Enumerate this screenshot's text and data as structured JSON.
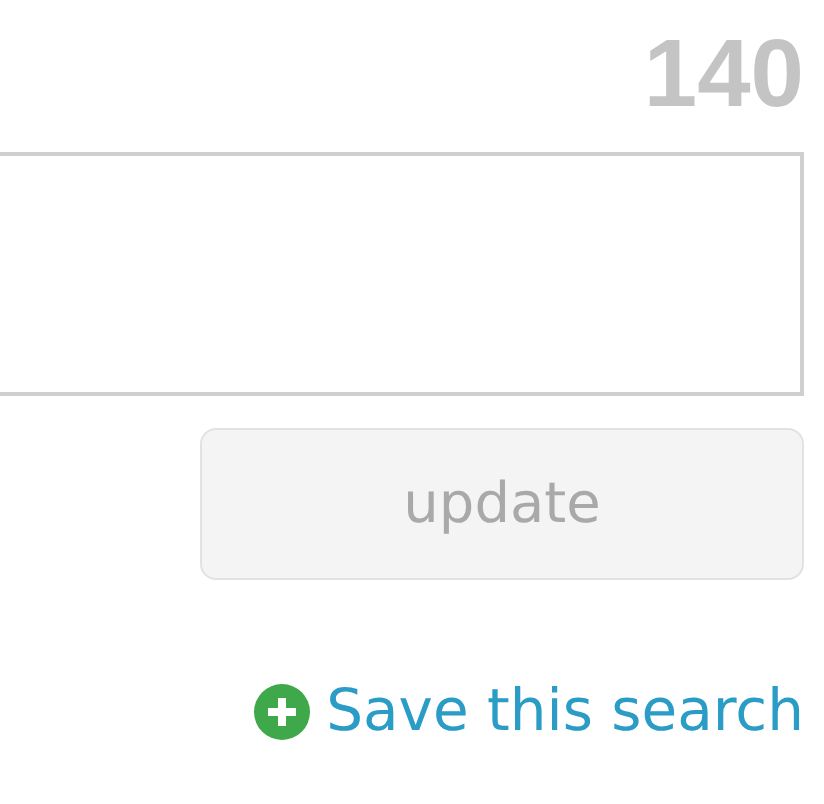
{
  "char_counter": "140",
  "update_button": {
    "label": "update",
    "disabled": true
  },
  "save_search_link": {
    "label": "Save this search"
  }
}
